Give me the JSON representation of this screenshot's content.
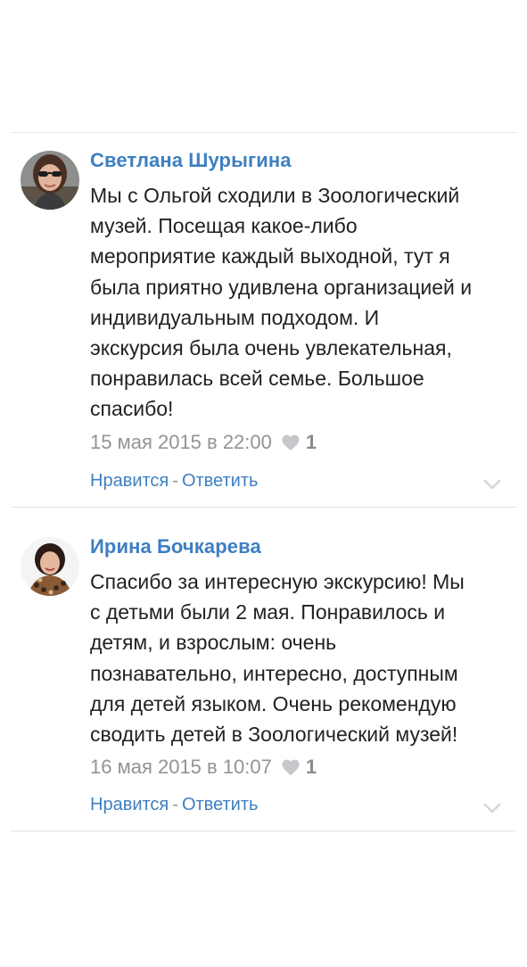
{
  "comments": [
    {
      "author": "Светлана Шурыгина",
      "text": "Мы с Ольгой сходили в Зоологический\nмузей. Посещая какое-либо\nмероприятие каждый выходной, тут я\nбыла приятно удивлена организацией и\nиндивидуальным подходом. И\nэкскурсия была очень увлекательная,\nпонравилась всей семье. Большое\nспасибо!",
      "date": "15 мая 2015 в 22:00",
      "likes": "1",
      "like_label": "Нравится",
      "separator": "-",
      "reply_label": "Ответить"
    },
    {
      "author": "Ирина Бочкарева",
      "text": "Спасибо за интересную экскурсию! Мы\nс детьми были 2 мая. Понравилось и\nдетям, и взрослым: очень\nпознавательно, интересно, доступным\nдля детей языком. Очень рекомендую\nсводить детей в Зоологический музей!",
      "date": "16 мая 2015 в 10:07",
      "likes": "1",
      "like_label": "Нравится",
      "separator": "-",
      "reply_label": "Ответить"
    }
  ],
  "icons": {
    "like": "heart-icon",
    "expand": "chevron-down-icon"
  },
  "colors": {
    "author": "#3e7fc1",
    "link": "#3e7fc1",
    "meta": "#939393",
    "text": "#222222",
    "divider": "#e7e8ec"
  }
}
